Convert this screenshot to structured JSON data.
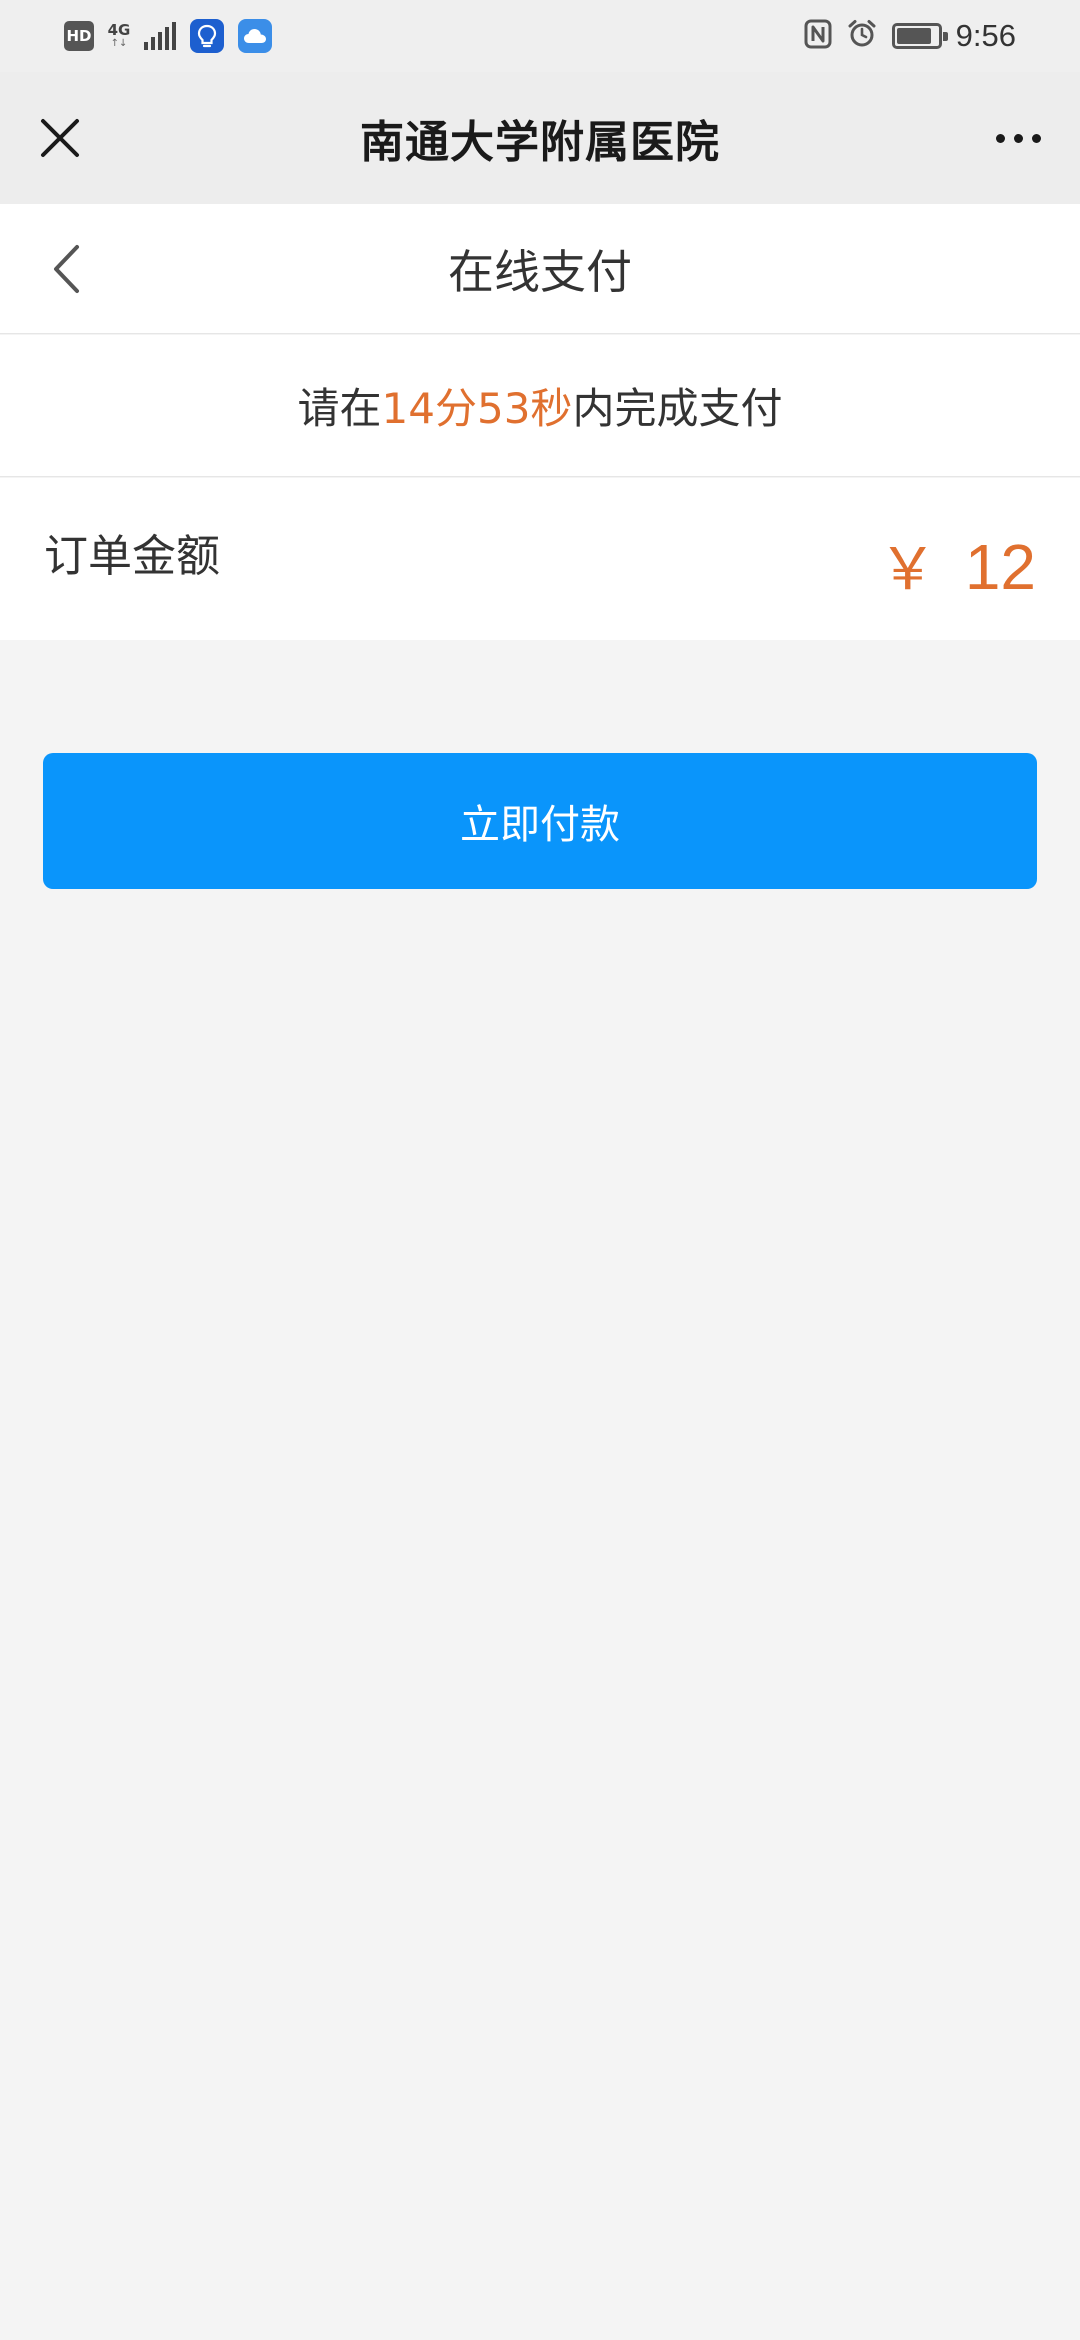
{
  "status_bar": {
    "hd_label": "HD",
    "network_label": "4G",
    "network_arrows": "↑↓",
    "time": "9:56",
    "battery_level": 0.85,
    "icons": [
      "hd-badge-icon",
      "signal-icon",
      "bulb-app-icon",
      "cloud-app-icon",
      "nfc-icon",
      "alarm-icon",
      "battery-icon"
    ]
  },
  "topbar": {
    "title": "南通大学附属医院",
    "close_icon": "close-icon",
    "more_icon": "more-dots-icon"
  },
  "page": {
    "title": "在线支付",
    "back_icon": "chevron-left-icon"
  },
  "countdown": {
    "prefix": "请在",
    "time": "14分53秒",
    "suffix": "内完成支付"
  },
  "order": {
    "label": "订单金额",
    "currency": "￥",
    "amount": "12"
  },
  "pay_button": {
    "label": "立即付款"
  },
  "colors": {
    "accent_orange": "#e0702f",
    "button_blue": "#0a95fb",
    "topbar_bg": "#ededed",
    "page_bg": "#f4f4f4"
  }
}
